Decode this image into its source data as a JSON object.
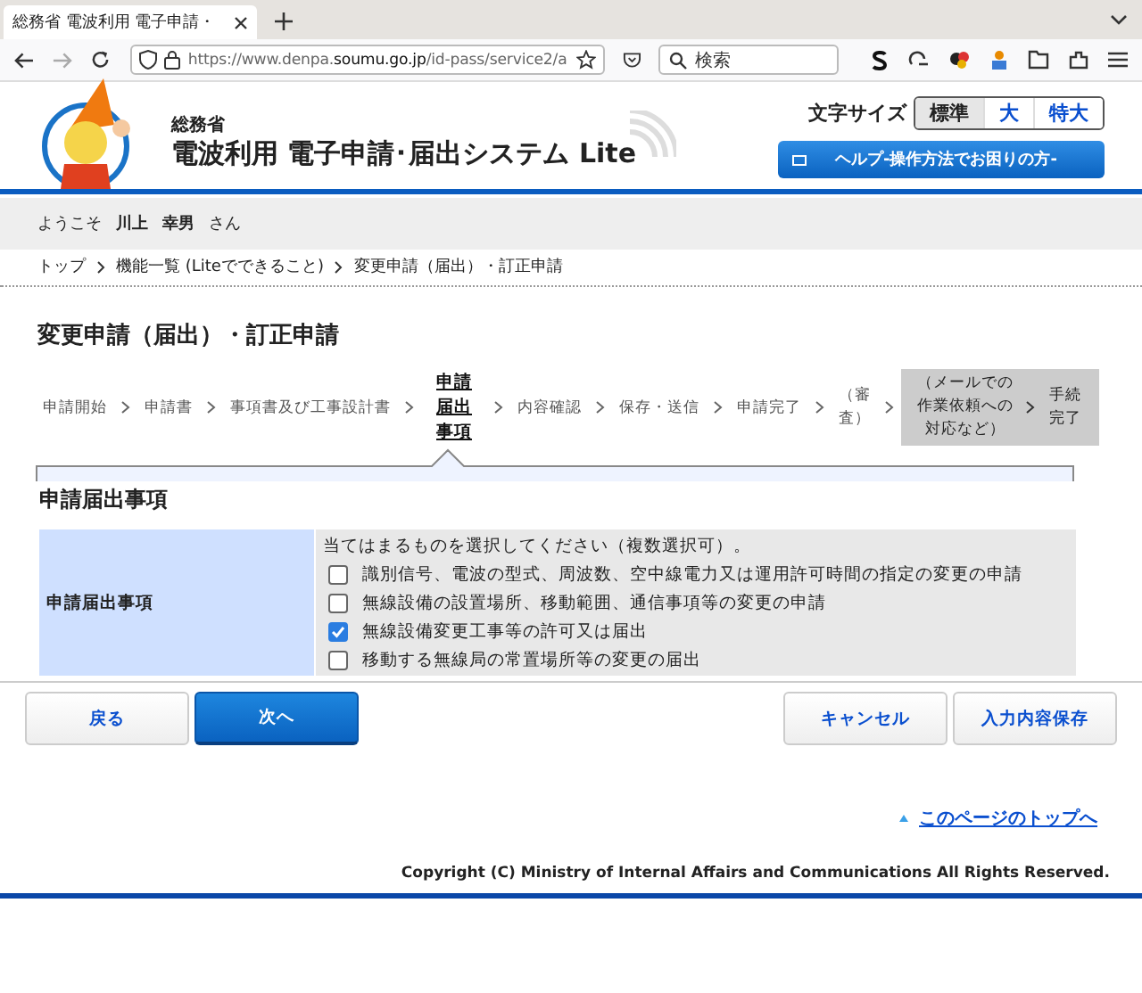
{
  "browser": {
    "tab_title": "総務省 電波利用 電子申請・",
    "url_domain_prefix": "https://www.denpa.",
    "url_domain": "soumu.go.jp",
    "url_path": "/id-pass/service2/a",
    "search_placeholder": "検索"
  },
  "header": {
    "ministry": "総務省",
    "system_title": "電波利用 電子申請･届出システム Lite",
    "font_size_label": "文字サイズ",
    "font_sizes": [
      {
        "label": "標準",
        "selected": true
      },
      {
        "label": "大",
        "selected": false
      },
      {
        "label": "特大",
        "selected": false
      }
    ],
    "help_button": "ヘルプ-操作方法でお困りの方-"
  },
  "welcome": {
    "greeting": "ようこそ",
    "last_name": "川上",
    "first_name": "幸男",
    "suffix": "さん"
  },
  "breadcrumb": [
    "トップ",
    "機能一覧 (Liteでできること)",
    "変更申請（届出）・訂正申請"
  ],
  "page_title": "変更申請（届出）・訂正申請",
  "steps": [
    {
      "label": "申請開始",
      "selected": false
    },
    {
      "label": "申請書",
      "selected": false
    },
    {
      "label": "事項書及び工事設計書",
      "selected": false
    },
    {
      "label": "申請届出事項",
      "selected": true
    },
    {
      "label": "内容確認",
      "selected": false
    },
    {
      "label": "保存・送信",
      "selected": false
    },
    {
      "label": "申請完了",
      "selected": false
    },
    {
      "label": "（審査）",
      "selected": false
    }
  ],
  "after_steps": [
    {
      "label": "（メールでの作業依頼への対応など）"
    },
    {
      "label": "手続完了"
    }
  ],
  "section_title": "申請届出事項",
  "form": {
    "label": "申請届出事項",
    "instruction": "当てはまるものを選択してください（複数選択可）。",
    "options": [
      {
        "label": "識別信号、電波の型式、周波数、空中線電力又は運用許可時間の指定の変更の申請",
        "checked": false
      },
      {
        "label": "無線設備の設置場所、移動範囲、通信事項等の変更の申請",
        "checked": false
      },
      {
        "label": "無線設備変更工事等の許可又は届出",
        "checked": true
      },
      {
        "label": "移動する無線局の常置場所等の変更の届出",
        "checked": false
      }
    ]
  },
  "buttons": {
    "back": "戻る",
    "next": "次へ",
    "cancel": "キャンセル",
    "save": "入力内容保存"
  },
  "page_top_link": "このページのトップへ",
  "copyright": "Copyright (C) Ministry of Internal Affairs and Communications All Rights Reserved."
}
